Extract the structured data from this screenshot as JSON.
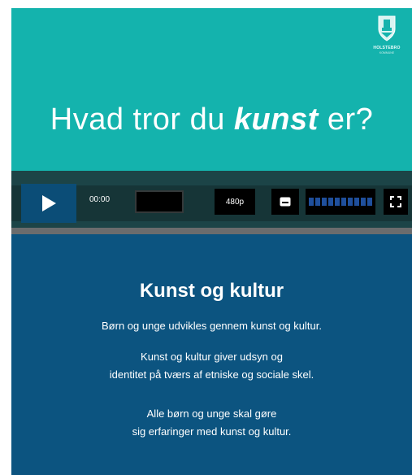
{
  "video": {
    "headline_pre": "Hvad tror du ",
    "headline_em": "kunst",
    "headline_post": " er?",
    "logo_name": "HOLSTEBRO",
    "logo_sub": "KOMMUNE"
  },
  "player": {
    "time": "00:00",
    "quality": "480p",
    "volume_level": 1.0,
    "progress": 0
  },
  "info": {
    "title": "Kunst og kultur",
    "paragraph1": "Børn og unge udvikles gennem kunst og kultur.",
    "paragraph2_line1": "Kunst og kultur giver udsyn og",
    "paragraph2_line2": "identitet på tværs af etniske og sociale skel.",
    "paragraph3_line1": "Alle børn og unge skal gøre",
    "paragraph3_line2": "sig erfaringer med kunst og kultur."
  },
  "colors": {
    "video_bg": "#14b3ad",
    "controls_bg": "#163537",
    "play_bg": "#0b4d77",
    "info_bg": "#0c5480",
    "volume_bar": "#1f4f9c"
  },
  "icons": {
    "play": "play-icon",
    "captions": "captions-icon",
    "fullscreen": "fullscreen-icon",
    "logo": "holstebro-crest-icon"
  }
}
